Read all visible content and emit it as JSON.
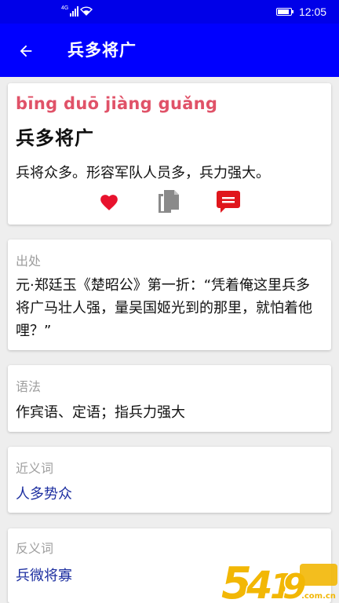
{
  "status_bar": {
    "network": "4G",
    "time": "12:05",
    "battery_level": 0.85
  },
  "app_bar": {
    "title": "兵多将广"
  },
  "entry": {
    "pinyin": "bīng duō jiàng guǎng",
    "word": "兵多将广",
    "meaning": "兵将众多。形容军队人员多，兵力强大。",
    "actions": [
      "favorite-icon",
      "copy-icon",
      "comment-icon"
    ]
  },
  "source": {
    "label": "出处",
    "text": "元·郑廷玉《楚昭公》第一折：“凭着俺这里兵多将广马壮人强，量吴国姬光到的那里，就怕着他哩？”"
  },
  "grammar": {
    "label": "语法",
    "text": "作宾语、定语；指兵力强大"
  },
  "synonyms": {
    "label": "近义词",
    "items": [
      "人多势众"
    ]
  },
  "antonyms": {
    "label": "反义词",
    "items": [
      "兵微将寡"
    ]
  },
  "colors": {
    "status_bar": "#0000e8",
    "app_bar": "#0000ff",
    "pinyin": "#e05268",
    "heart": "#e8122d",
    "link": "#1d2fa0"
  }
}
